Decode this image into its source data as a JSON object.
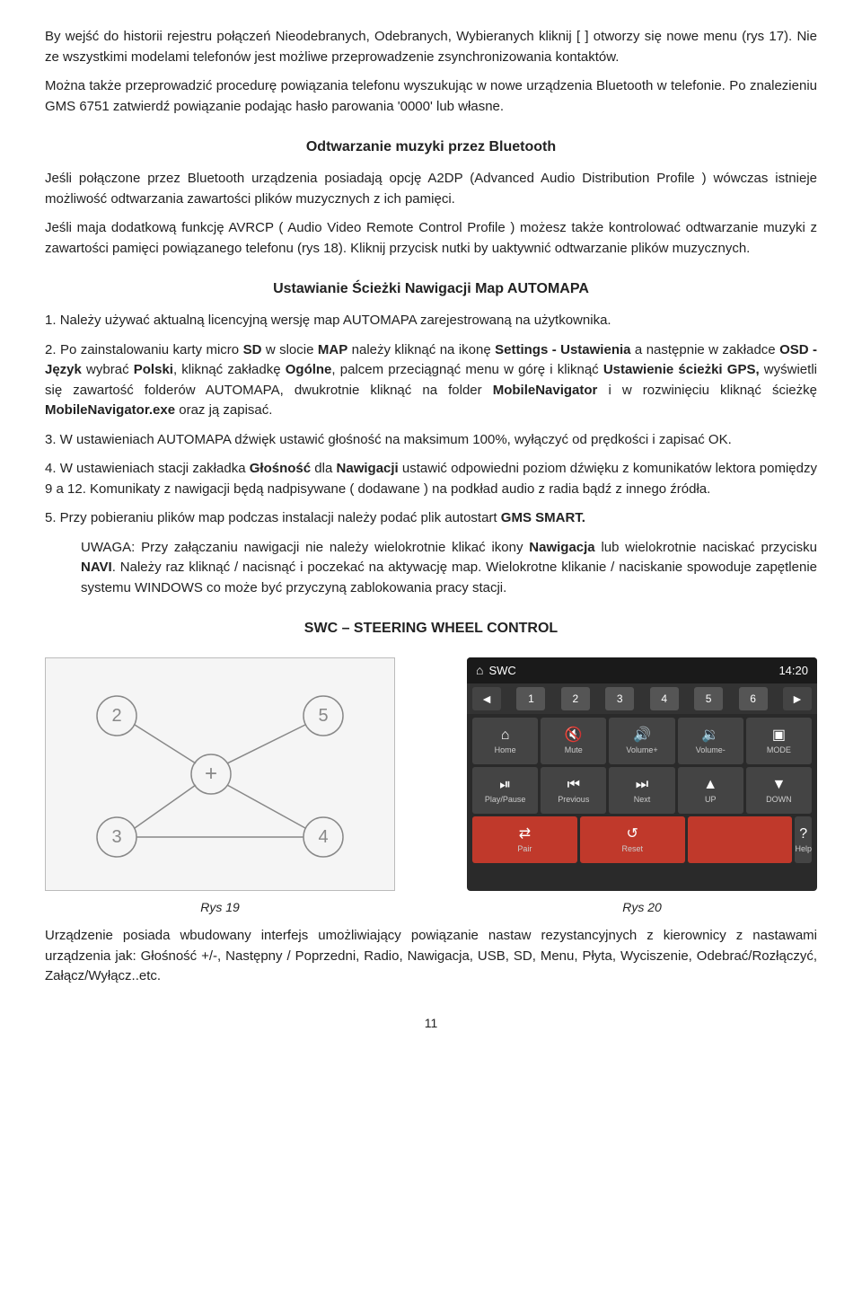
{
  "page": {
    "number": "11"
  },
  "paragraphs": {
    "intro1": "By wejść do historii rejestru połączeń Nieodebranych, Odebranych, Wybieranych kliknij [  ] otworzy się nowe menu (rys 17). Nie ze wszystkimi modelami telefonów jest możliwe przeprowadzenie zsynchronizowania kontaktów.",
    "intro2": "Można także przeprowadzić procedurę powiązania telefonu wyszukując w nowe urządzenia Bluetooth w telefonie. Po znalezieniu GMS 6751 zatwierdź powiązanie podając hasło parowania '0000' lub własne."
  },
  "bluetooth_heading": "Odtwarzanie muzyki przez Bluetooth",
  "bluetooth_paragraphs": {
    "p1": "Jeśli połączone przez Bluetooth urządzenia posiadają opcję A2DP (Advanced Audio Distribution Profile ) wówczas istnieje możliwość odtwarzania zawartości plików muzycznych z ich pamięci.",
    "p2": "Jeśli maja dodatkową funkcję AVRCP ( Audio Video Remote Control Profile ) możesz także kontrolować odtwarzanie muzyki z zawartości pamięci powiązanego telefonu (rys 18). Kliknij przycisk nutki by uaktywnić odtwarzanie plików muzycznych."
  },
  "nav_heading": "Ustawianie Ścieżki Nawigacji Map AUTOMAPA",
  "nav_items": [
    {
      "num": "1",
      "text": "Należy używać aktualną licencyjną wersję map AUTOMAPA zarejestrowaną na użytkownika."
    },
    {
      "num": "2",
      "text": "Po zainstalowaniu karty micro SD w slocie MAP należy kliknąć na ikonę Settings - Ustawienia a następnie w zakładce OSD - Język wybrać Polski, kliknąć zakładkę Ogólne, palcem przeciągnąć menu w górę i kliknąć Ustawienie ścieżki GPS, wyświetli się zawartość folderów AUTOMAPA, dwukrotnie kliknąć na folder MobileNavigator i w rozwinięciu kliknąć ścieżkę MobileNavigator.exe oraz ją zapisać."
    },
    {
      "num": "3",
      "text": "W ustawieniach AUTOMAPA dźwięk ustawić głośność na maksimum 100%, wyłączyć od prędkości i zapisać OK."
    },
    {
      "num": "4",
      "text": "W ustawieniach stacji zakładka Głośność dla Nawigacji ustawić odpowiedni poziom dźwięku z komunikatów lektora pomiędzy 9 a 12. Komunikaty z nawigacji będą nadpisywane ( dodawane ) na podkład audio z radia bądź z innego źródła."
    },
    {
      "num": "5",
      "text": "Przy pobieraniu plików map podczas instalacji należy podać plik autostart GMS SMART."
    }
  ],
  "uwaga": "UWAGA: Przy załączaniu nawigacji nie należy wielokrotnie klikać ikony Nawigacja lub wielokrotnie naciskać przycisku NAVI. Należy raz kliknąć / nacisnąć i poczekać na aktywację map. Wielokrotne klikanie / naciskanie spowoduje zapętlenie systemu WINDOWS co może być przyczyną zablokowania pracy stacji.",
  "swc_heading": "SWC – STEERING WHEEL CONTROL",
  "fig19": {
    "caption": "Rys 19",
    "labels": [
      "2",
      "5",
      "3",
      "4"
    ],
    "plus_symbol": "+"
  },
  "fig20": {
    "caption": "Rys 20",
    "header_icon": "⌂",
    "header_title": "SWC",
    "header_time": "14:20",
    "numbers": [
      "◄",
      "1",
      "2",
      "3",
      "4",
      "5",
      "6",
      "►"
    ],
    "buttons": [
      {
        "icon": "⌂",
        "label": "Home"
      },
      {
        "icon": "🔇",
        "label": "Mute"
      },
      {
        "icon": "🔊+",
        "label": "Volume+"
      },
      {
        "icon": "🔊-",
        "label": "Volume-"
      },
      {
        "icon": "📷",
        "label": "MODE"
      }
    ],
    "buttons2": [
      {
        "icon": "⏯",
        "label": "Play/Pause"
      },
      {
        "icon": "⏮",
        "label": "Previous"
      },
      {
        "icon": "⏭",
        "label": "Next"
      },
      {
        "icon": "▲",
        "label": "UP"
      },
      {
        "icon": "▼",
        "label": "DOWN"
      }
    ],
    "buttons3": [
      {
        "icon": "⇄",
        "label": "Pair",
        "red": true
      },
      {
        "icon": "↺",
        "label": "Reset",
        "red": true
      },
      {
        "icon": "",
        "label": "",
        "red": true
      },
      {
        "icon": "?",
        "label": "Help"
      }
    ]
  },
  "footer_text": "Urządzenie posiada wbudowany interfejs umożliwiający powiązanie nastaw rezystancyjnych z kierownicy z nastawami urządzenia jak: Głośność +/-, Następny / Poprzedni, Radio, Nawigacja, USB, SD, Menu, Płyta, Wyciszenie, Odebrać/Rozłączyć, Załącz/Wyłącz..etc."
}
